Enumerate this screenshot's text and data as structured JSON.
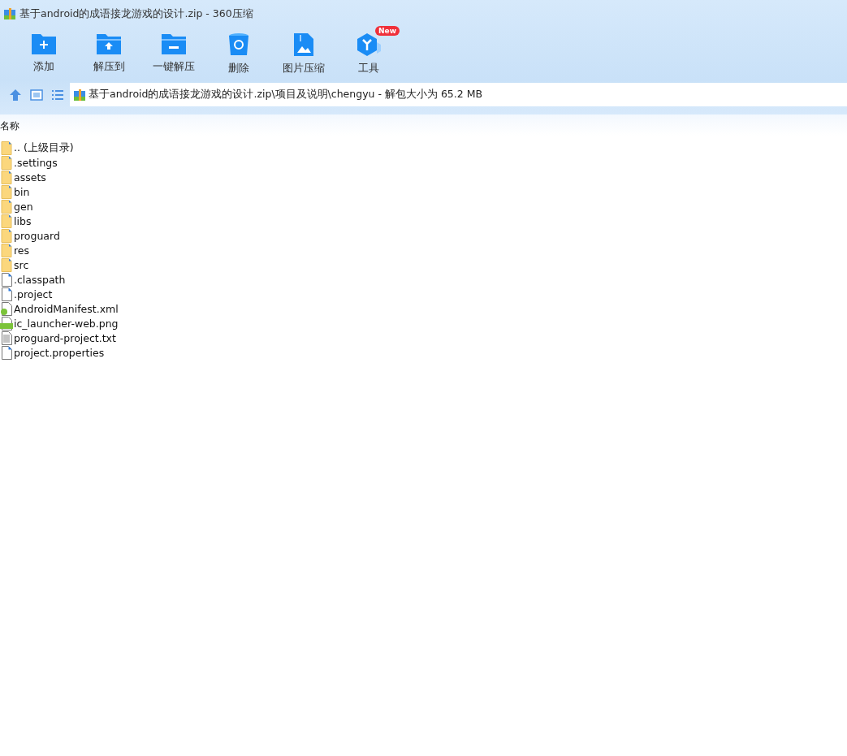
{
  "window": {
    "title": "基于android的成语接龙游戏的设计.zip - 360压缩"
  },
  "toolbar": [
    {
      "kind": "add",
      "label": "添加"
    },
    {
      "kind": "extract",
      "label": "解压到"
    },
    {
      "kind": "oneclick",
      "label": "一键解压"
    },
    {
      "kind": "delete",
      "label": "删除"
    },
    {
      "kind": "image",
      "label": "图片压缩"
    },
    {
      "kind": "tools",
      "label": "工具",
      "badge": "New"
    }
  ],
  "address": {
    "path": "基于android的成语接龙游戏的设计.zip\\项目及说明\\chengyu - 解包大小为 65.2 MB"
  },
  "table": {
    "columns": [
      "名称"
    ],
    "rows": [
      {
        "kind": "folder",
        "name": ".. (上级目录)"
      },
      {
        "kind": "folder",
        "name": ".settings"
      },
      {
        "kind": "folder",
        "name": "assets"
      },
      {
        "kind": "folder",
        "name": "bin"
      },
      {
        "kind": "folder",
        "name": "gen"
      },
      {
        "kind": "folder",
        "name": "libs"
      },
      {
        "kind": "folder",
        "name": "proguard"
      },
      {
        "kind": "folder",
        "name": "res"
      },
      {
        "kind": "folder",
        "name": "src"
      },
      {
        "kind": "file",
        "name": ".classpath"
      },
      {
        "kind": "file",
        "name": ".project"
      },
      {
        "kind": "xml",
        "name": "AndroidManifest.xml"
      },
      {
        "kind": "png",
        "name": "ic_launcher-web.png"
      },
      {
        "kind": "text",
        "name": "proguard-project.txt"
      },
      {
        "kind": "file",
        "name": "project.properties"
      }
    ]
  }
}
